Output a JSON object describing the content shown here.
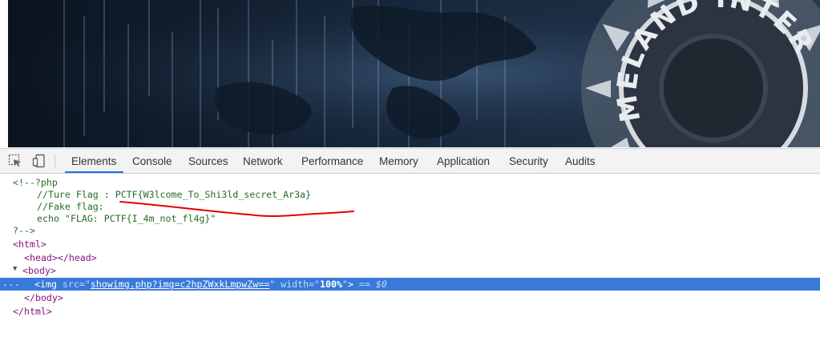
{
  "banner": {
    "text": "MELAND INTERV"
  },
  "devtools": {
    "tabs": [
      {
        "label": "Elements",
        "active": true
      },
      {
        "label": "Console"
      },
      {
        "label": "Sources"
      },
      {
        "label": "Network"
      },
      {
        "label": "Performance"
      },
      {
        "label": "Memory"
      },
      {
        "label": "Application"
      },
      {
        "label": "Security"
      },
      {
        "label": "Audits"
      }
    ],
    "dom": {
      "comment_open": "<!--?php",
      "true_flag": "//Ture Flag : PCTF{W3lcome_To_Shi3ld_secret_Ar3a}",
      "fake_flag": "//Fake flag:",
      "echo": "echo \"FLAG: PCTF{I_4m_not_fl4g}\"",
      "comment_close": "?-->",
      "html_open": "<html>",
      "head_open": "<head>",
      "head_close": "</head>",
      "body_open": "<body>",
      "img_tag_open": "<img",
      "src_attr": "src",
      "src_value": "showimg.php?img=c2hpZWxkLmpwZw==",
      "width_attr": "width",
      "width_value": "100%",
      "img_tag_close": ">",
      "selected_marker": "== $0",
      "ellipsis": "...",
      "body_close": "</body>",
      "html_close": "</html>"
    }
  },
  "colors": {
    "selection": "#3879d9",
    "tab_underline": "#1a73e8",
    "annotation": "#e00000"
  }
}
